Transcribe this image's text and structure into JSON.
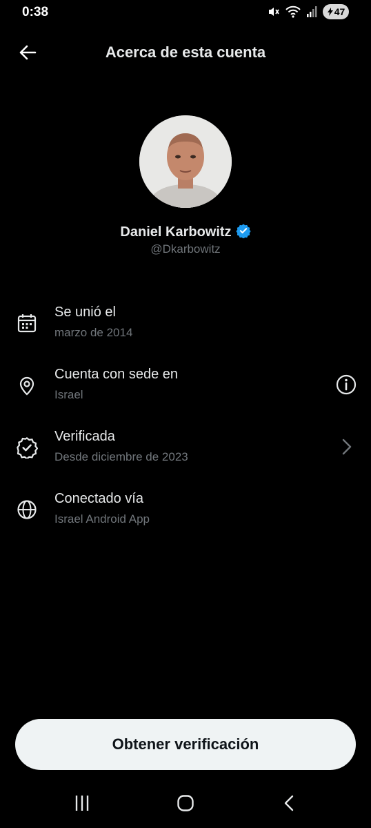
{
  "status_bar": {
    "time": "0:38",
    "battery_level": "47",
    "icons": [
      "mute-icon",
      "wifi-icon",
      "signal-icon",
      "battery-icon"
    ]
  },
  "header": {
    "title": "Acerca de esta cuenta",
    "back_icon": "arrow-left-icon"
  },
  "profile": {
    "name": "Daniel Karbowitz",
    "handle": "@Dkarbowitz",
    "verified_color": "#1d9bf0"
  },
  "rows": [
    {
      "title": "Se unió el",
      "subtitle": "marzo de 2014",
      "icon": "calendar-icon"
    },
    {
      "title": "Cuenta con sede en",
      "subtitle": "Israel",
      "icon": "location-pin-icon",
      "trailing_icon": "info-icon"
    },
    {
      "title": "Verificada",
      "subtitle": "Desde diciembre de 2023",
      "icon": "verified-badge-icon",
      "trailing_icon": "chevron-right-icon"
    },
    {
      "title": "Conectado vía",
      "subtitle": "Israel Android App",
      "icon": "globe-icon"
    }
  ],
  "cta": {
    "label": "Obtener verificación"
  },
  "nav_bar": {
    "icons": [
      "recent-apps-icon",
      "home-icon",
      "back-icon"
    ]
  },
  "colors": {
    "background": "#000000",
    "primary_text": "#e7e9ea",
    "secondary_text": "#71767b",
    "button_bg": "#eff3f4",
    "button_text": "#0f1419"
  }
}
